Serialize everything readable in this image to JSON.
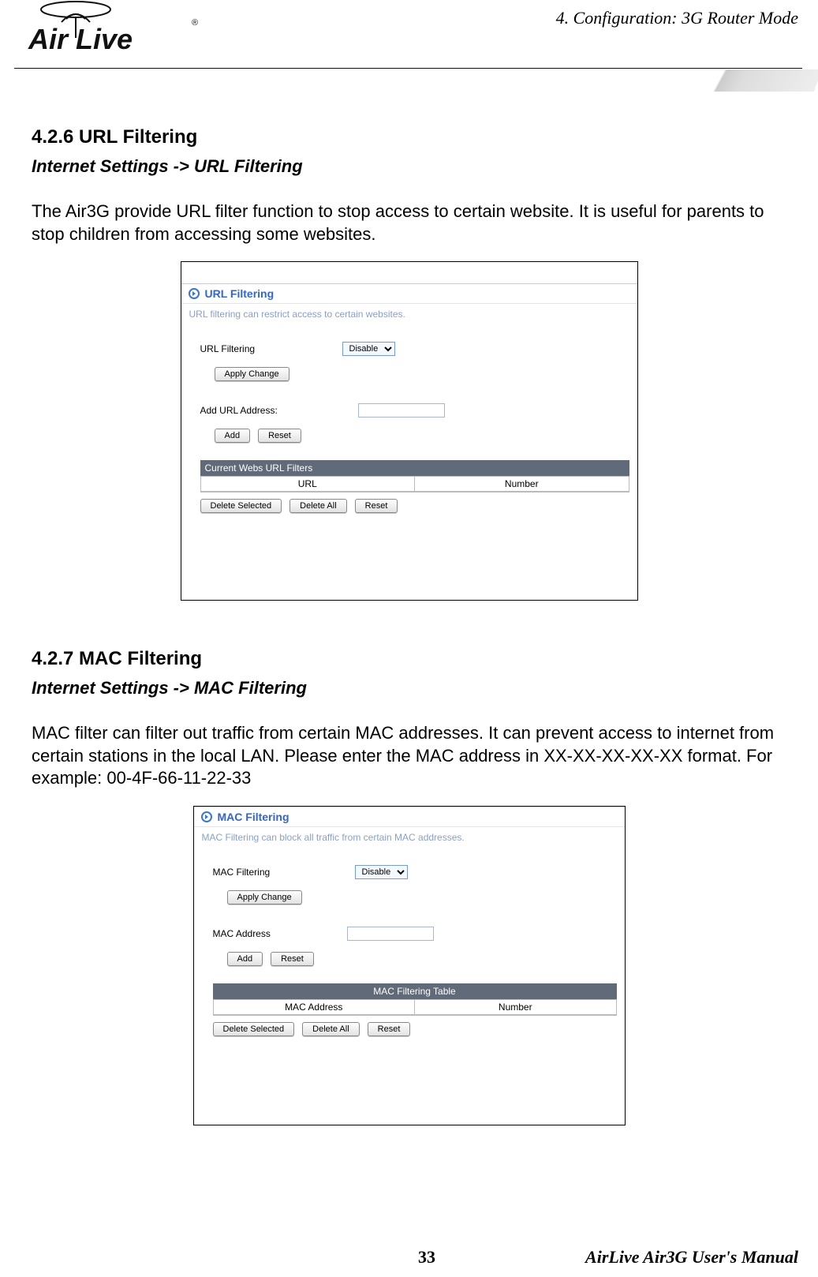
{
  "chapter": "4.  Configuration:  3G  Router  Mode",
  "logo_text": "Air Live",
  "section1": {
    "number": "4.2.6 URL Filtering",
    "breadcrumb": "Internet Settings -> URL Filtering",
    "desc": "The Air3G provide URL filter function to stop access to certain website. It is useful for parents to stop children from accessing some websites.",
    "panel": {
      "title": "URL Filtering",
      "sub": "URL filtering can restrict access to certain websites.",
      "row1_label": "URL Filtering",
      "row1_value": "Disable",
      "apply": "Apply Change",
      "add_label": "Add URL Address:",
      "add_btn": "Add",
      "reset_btn": "Reset",
      "tbl_head": "Current Webs URL Filters",
      "col1": "URL",
      "col2": "Number",
      "del_sel": "Delete Selected",
      "del_all": "Delete All",
      "reset2": "Reset"
    }
  },
  "section2": {
    "number": "4.2.7 MAC Filtering",
    "breadcrumb": "Internet Settings -> MAC Filtering",
    "desc": "MAC filter can filter out traffic from certain MAC addresses. It can prevent access to internet from certain stations in the local LAN.    Please enter the MAC address in XX-XX-XX-XX-XX format.    For example: 00-4F-66-11-22-33",
    "panel": {
      "title": "MAC Filtering",
      "sub": "MAC Filtering can block all traffic from certain MAC addresses.",
      "row1_label": "MAC Filtering",
      "row1_value": "Disable",
      "apply": "Apply Change",
      "add_label": "MAC Address",
      "add_btn": "Add",
      "reset_btn": "Reset",
      "tbl_head": "MAC Filtering Table",
      "col1": "MAC Address",
      "col2": "Number",
      "del_sel": "Delete Selected",
      "del_all": "Delete All",
      "reset2": "Reset"
    }
  },
  "footer": {
    "page": "33",
    "manual": "AirLive  Air3G  User's  Manual"
  }
}
